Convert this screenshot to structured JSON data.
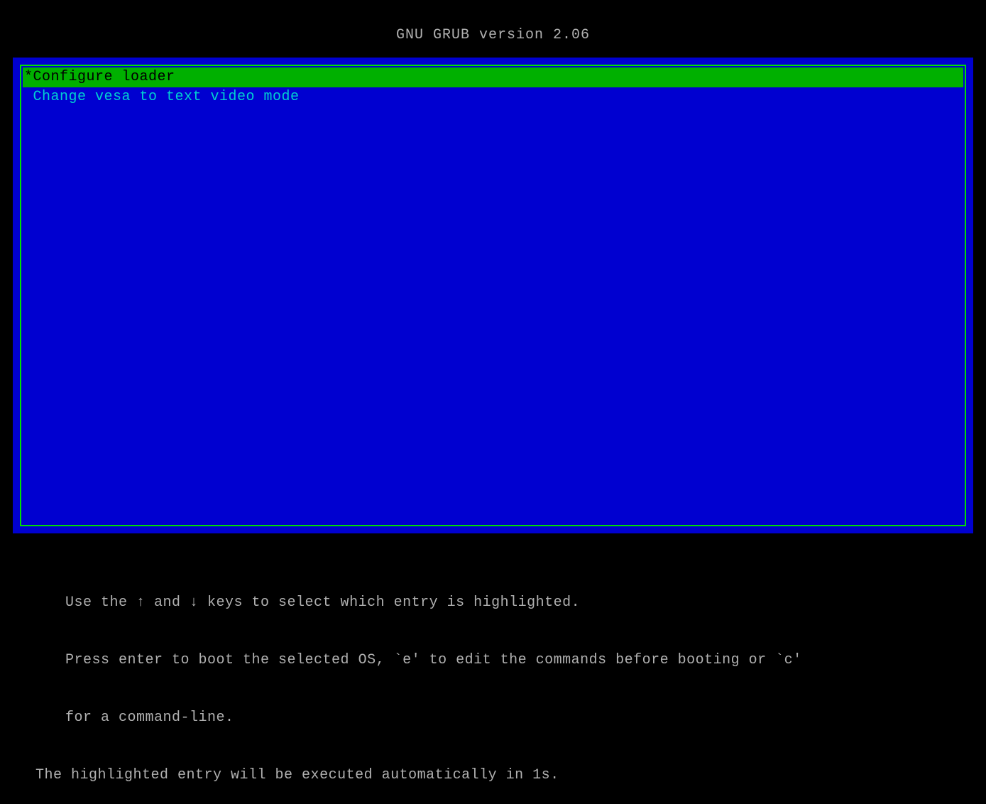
{
  "title": "GNU GRUB  version 2.06",
  "menu": {
    "items": [
      {
        "label": "*Configure loader",
        "selected": true
      },
      {
        "label": " Change vesa to text video mode",
        "selected": false
      }
    ]
  },
  "footer": {
    "line1": "Use the ↑ and ↓ keys to select which entry is highlighted.",
    "line2": "Press enter to boot the selected OS, `e' to edit the commands before booting or `c'",
    "line3": "for a command-line.",
    "line4": "The highlighted entry will be executed automatically in 1s."
  }
}
